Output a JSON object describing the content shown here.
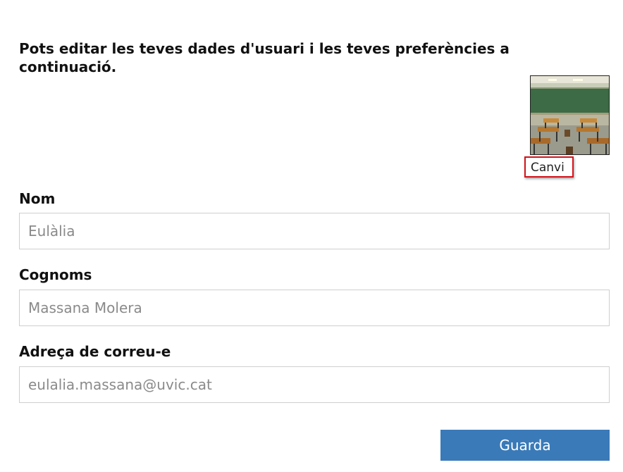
{
  "intro": {
    "text": "Pots editar les teves dades d'usuari i les teves preferències a continuació."
  },
  "avatar": {
    "change_label": "Canvi",
    "highlight_color": "#d2141c"
  },
  "form": {
    "first_name": {
      "label": "Nom",
      "value": "Eulàlia"
    },
    "last_name": {
      "label": "Cognoms",
      "value": "Massana Molera"
    },
    "email": {
      "label": "Adreça de correu-e",
      "value": "eulalia.massana@uvic.cat"
    }
  },
  "actions": {
    "save_label": "Guarda",
    "save_color": "#3a7ab8"
  }
}
